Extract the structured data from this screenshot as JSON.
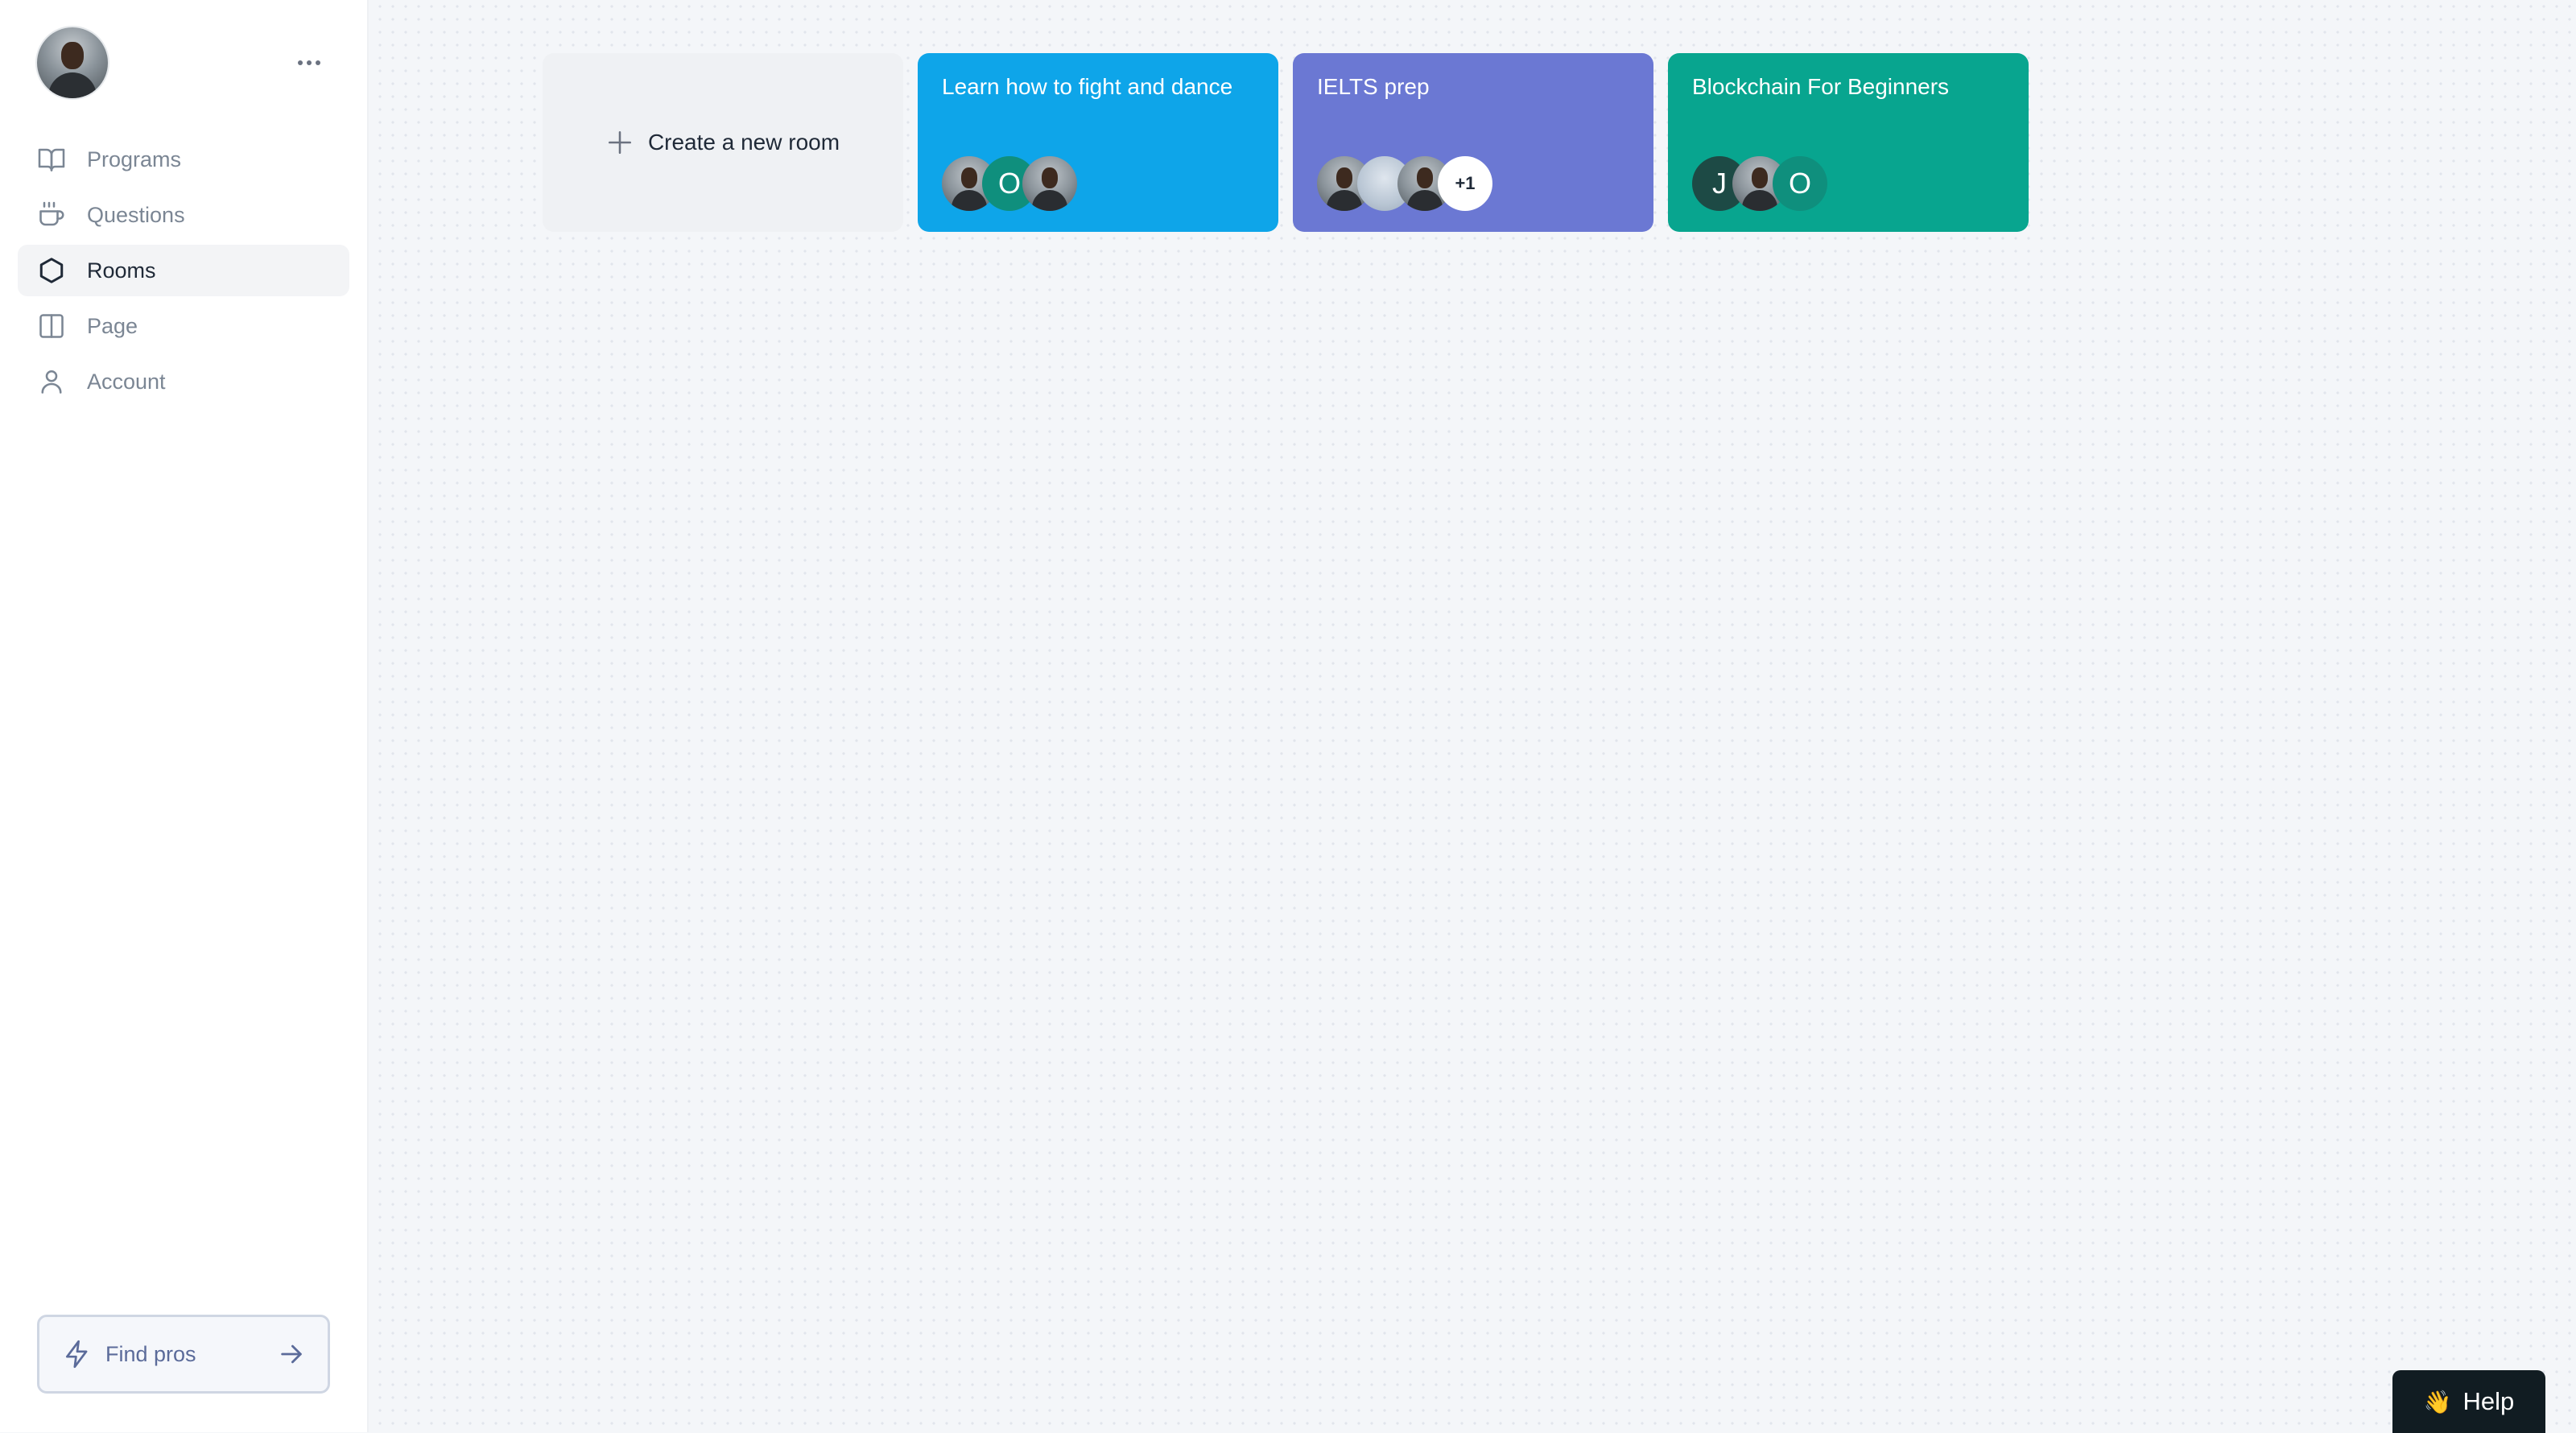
{
  "sidebar": {
    "profile_avatar": "user-avatar",
    "more_icon": "more-horizontal-icon",
    "items": [
      {
        "label": "Programs",
        "icon": "book-open-icon",
        "active": false
      },
      {
        "label": "Questions",
        "icon": "coffee-icon",
        "active": false
      },
      {
        "label": "Rooms",
        "icon": "hexagon-icon",
        "active": true
      },
      {
        "label": "Page",
        "icon": "columns-icon",
        "active": false
      },
      {
        "label": "Account",
        "icon": "user-icon",
        "active": false
      }
    ],
    "find_pros": {
      "label": "Find pros",
      "icon": "zap-icon",
      "arrow_icon": "arrow-right-icon"
    }
  },
  "rooms": {
    "create": {
      "label": "Create a new room",
      "icon": "plus-icon"
    },
    "cards": [
      {
        "title": "Learn how to fight and dance",
        "color": "#0ea5e9",
        "members": [
          {
            "type": "photo"
          },
          {
            "type": "initial",
            "text": "O",
            "color": "#0f8f7d"
          },
          {
            "type": "photo"
          }
        ]
      },
      {
        "title": "IELTS prep",
        "color": "#6b78d3",
        "members": [
          {
            "type": "photo"
          },
          {
            "type": "photo-light"
          },
          {
            "type": "photo"
          },
          {
            "type": "count",
            "text": "+1"
          }
        ]
      },
      {
        "title": "Blockchain For Beginners",
        "color": "#08a58f",
        "members": [
          {
            "type": "initial",
            "text": "J",
            "color": "#1d4a45"
          },
          {
            "type": "photo"
          },
          {
            "type": "initial",
            "text": "O",
            "color": "#0f8f7d"
          }
        ]
      }
    ]
  },
  "help": {
    "label": "Help",
    "icon": "waving-hand-icon",
    "emoji": "👋"
  }
}
